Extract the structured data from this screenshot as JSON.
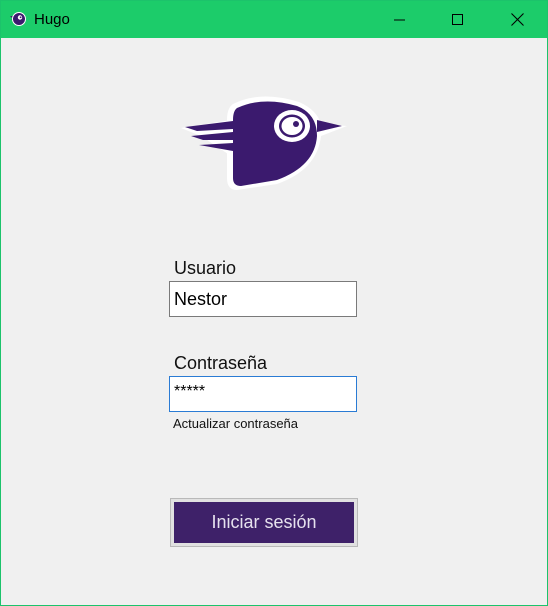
{
  "window": {
    "title": "Hugo",
    "controls": [
      "minimize",
      "maximize",
      "close"
    ],
    "accent_color": "#1ccc6a"
  },
  "logo": {
    "icon": "bird-logo-icon",
    "color": "#3b1a6e"
  },
  "form": {
    "username_label": "Usuario",
    "username_value": "Nestor",
    "password_label": "Contraseña",
    "password_value": "*****",
    "update_password_link": "Actualizar contraseña",
    "login_button": "Iniciar sesión",
    "button_color": "#3e2169"
  }
}
